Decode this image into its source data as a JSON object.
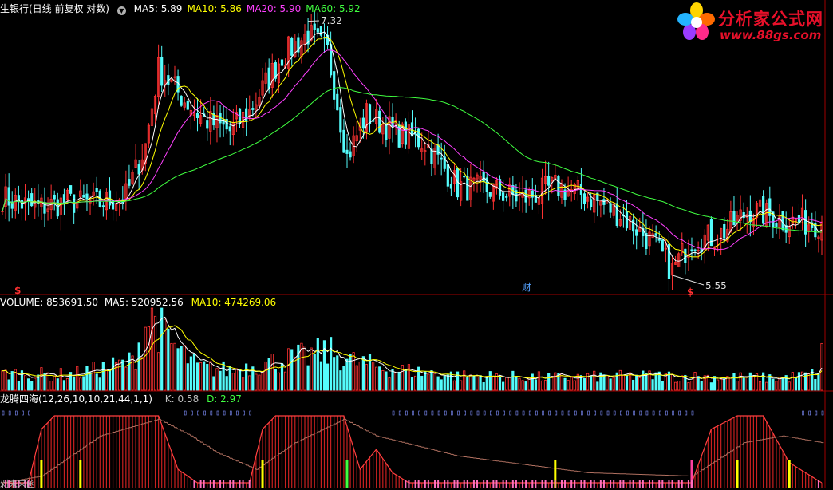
{
  "header": {
    "stock_title": "生银行(日线 前复权 对数)",
    "menu_icon": "circle-chevron-down-icon",
    "ma": [
      {
        "label": "MA5: 5.89",
        "color": "#ffffff"
      },
      {
        "label": "MA10: 5.86",
        "color": "#ffff00"
      },
      {
        "label": "MA20: 5.90",
        "color": "#ff40ff"
      },
      {
        "label": "MA60: 5.92",
        "color": "#40ff40"
      }
    ]
  },
  "logo": {
    "name": "分析家公式网",
    "url_text": "www.88gs.com",
    "icon": "flower-icon"
  },
  "volume_header": {
    "volume": "VOLUME: 853691.50",
    "ma5": "MA5: 520952.56",
    "ma10": "MA10: 474269.06"
  },
  "indicator_header": {
    "name": "龙腾四海(12,26,10,10,21,44,1,1)",
    "k": "K: 0.58",
    "d": "D: 2.97"
  },
  "annotations": {
    "high_label": "7.32",
    "low_label": "5.55",
    "cai_marker": "财",
    "s_marker": "$"
  },
  "bottom_note": "剁未来函",
  "colors": {
    "up": "#ff3232",
    "down": "#54fcfc",
    "ma5": "#ffffff",
    "ma10": "#ffff00",
    "ma20": "#ff40ff",
    "ma60": "#40ff40",
    "panel_border": "#a00000"
  },
  "chart_data": [
    {
      "type": "candlestick",
      "title": "生银行(日线 前复权 对数)",
      "scale": "log",
      "annotations": [
        {
          "label": "7.32",
          "type": "high"
        },
        {
          "label": "5.55",
          "type": "low"
        }
      ],
      "segments_close": [
        [
          0,
          6.05
        ],
        [
          10,
          5.98
        ],
        [
          20,
          6.02
        ],
        [
          30,
          6.01
        ],
        [
          38,
          6.06
        ],
        [
          44,
          6.4
        ],
        [
          48,
          6.95
        ],
        [
          56,
          6.72
        ],
        [
          62,
          6.58
        ],
        [
          70,
          6.5
        ],
        [
          76,
          6.64
        ],
        [
          86,
          7.05
        ],
        [
          94,
          7.22
        ],
        [
          100,
          7.08
        ],
        [
          106,
          6.32
        ],
        [
          112,
          6.62
        ],
        [
          122,
          6.48
        ],
        [
          130,
          6.42
        ],
        [
          140,
          6.12
        ],
        [
          150,
          6.1
        ],
        [
          160,
          6.04
        ],
        [
          170,
          6.12
        ],
        [
          180,
          6.06
        ],
        [
          190,
          5.94
        ],
        [
          200,
          5.76
        ],
        [
          206,
          5.59
        ],
        [
          212,
          5.78
        ],
        [
          220,
          5.8
        ],
        [
          230,
          5.97
        ],
        [
          240,
          5.9
        ],
        [
          252,
          5.88
        ]
      ],
      "ma5": 5.89,
      "ma10": 5.86,
      "ma20": 5.9,
      "ma60": 5.92
    },
    {
      "type": "bar",
      "title": "VOLUME",
      "latest": 853691.5,
      "ma5": 520952.56,
      "ma10": 474269.06,
      "segments_volume": [
        [
          0,
          300000
        ],
        [
          20,
          280000
        ],
        [
          30,
          380000
        ],
        [
          40,
          520000
        ],
        [
          46,
          1500000
        ],
        [
          50,
          950000
        ],
        [
          60,
          420000
        ],
        [
          70,
          360000
        ],
        [
          80,
          480000
        ],
        [
          92,
          600000
        ],
        [
          100,
          700000
        ],
        [
          108,
          520000
        ],
        [
          120,
          380000
        ],
        [
          140,
          260000
        ],
        [
          170,
          230000
        ],
        [
          200,
          260000
        ],
        [
          220,
          240000
        ],
        [
          240,
          220000
        ],
        [
          251,
          300000
        ],
        [
          252,
          853691.5
        ]
      ]
    },
    {
      "type": "line",
      "title": "龙腾四海(12,26,10,10,21,44,1,1)",
      "k": 0.58,
      "d": 2.97,
      "ylim": [
        0,
        100
      ],
      "segments_k": [
        [
          0,
          0
        ],
        [
          8,
          0
        ],
        [
          12,
          80
        ],
        [
          16,
          100
        ],
        [
          48,
          100
        ],
        [
          54,
          20
        ],
        [
          60,
          0
        ],
        [
          76,
          0
        ],
        [
          80,
          80
        ],
        [
          84,
          100
        ],
        [
          105,
          100
        ],
        [
          110,
          20
        ],
        [
          115,
          50
        ],
        [
          120,
          15
        ],
        [
          125,
          0
        ],
        [
          212,
          0
        ],
        [
          218,
          80
        ],
        [
          226,
          100
        ],
        [
          234,
          100
        ],
        [
          242,
          30
        ],
        [
          252,
          0
        ]
      ],
      "segments_d": [
        [
          0,
          0
        ],
        [
          12,
          10
        ],
        [
          30,
          70
        ],
        [
          48,
          95
        ],
        [
          58,
          70
        ],
        [
          66,
          45
        ],
        [
          78,
          20
        ],
        [
          90,
          60
        ],
        [
          105,
          95
        ],
        [
          115,
          70
        ],
        [
          140,
          40
        ],
        [
          180,
          15
        ],
        [
          212,
          10
        ],
        [
          228,
          60
        ],
        [
          240,
          70
        ],
        [
          252,
          60
        ]
      ]
    }
  ]
}
